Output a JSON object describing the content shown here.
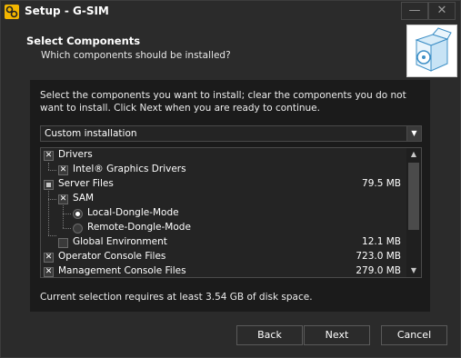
{
  "window": {
    "title": "Setup - G-SIM",
    "minimize_symbol": "—",
    "close_symbol": "✕",
    "icon": "setup-gear-icon"
  },
  "header": {
    "title": "Select Components",
    "subtitle": "Which components should be installed?",
    "image_icon": "software-box-icon"
  },
  "instructions": "Select the components you want to install; clear the components you do not want to install. Click Next when you are ready to continue.",
  "setup_type": {
    "value": "Custom installation",
    "dropdown_symbol": "▼"
  },
  "components": [
    {
      "label": "Drivers",
      "size": "",
      "control": "checkbox",
      "state": "checked"
    },
    {
      "label": "Intel® Graphics Drivers",
      "size": "",
      "control": "checkbox",
      "state": "checked"
    },
    {
      "label": "Server Files",
      "size": "79.5 MB",
      "control": "checkbox",
      "state": "partial"
    },
    {
      "label": "SAM",
      "size": "",
      "control": "checkbox",
      "state": "checked"
    },
    {
      "label": "Local-Dongle-Mode",
      "size": "",
      "control": "radio",
      "state": "selected"
    },
    {
      "label": "Remote-Dongle-Mode",
      "size": "",
      "control": "radio",
      "state": "unselected"
    },
    {
      "label": "Global Environment",
      "size": "12.1 MB",
      "control": "checkbox",
      "state": "unchecked"
    },
    {
      "label": "Operator Console Files",
      "size": "723.0 MB",
      "control": "checkbox",
      "state": "checked"
    },
    {
      "label": "Management Console Files",
      "size": "279.0 MB",
      "control": "checkbox",
      "state": "checked"
    }
  ],
  "scrollbar": {
    "up_symbol": "▲",
    "down_symbol": "▼"
  },
  "requirement_text": "Current selection requires at least 3.54 GB of disk space.",
  "buttons": {
    "back": "Back",
    "next": "Next",
    "cancel": "Cancel"
  },
  "colors": {
    "window_bg": "#2b2b2b",
    "panel_bg": "#1b1b1b",
    "list_bg": "#242424",
    "icon_accent": "#f2b600"
  }
}
